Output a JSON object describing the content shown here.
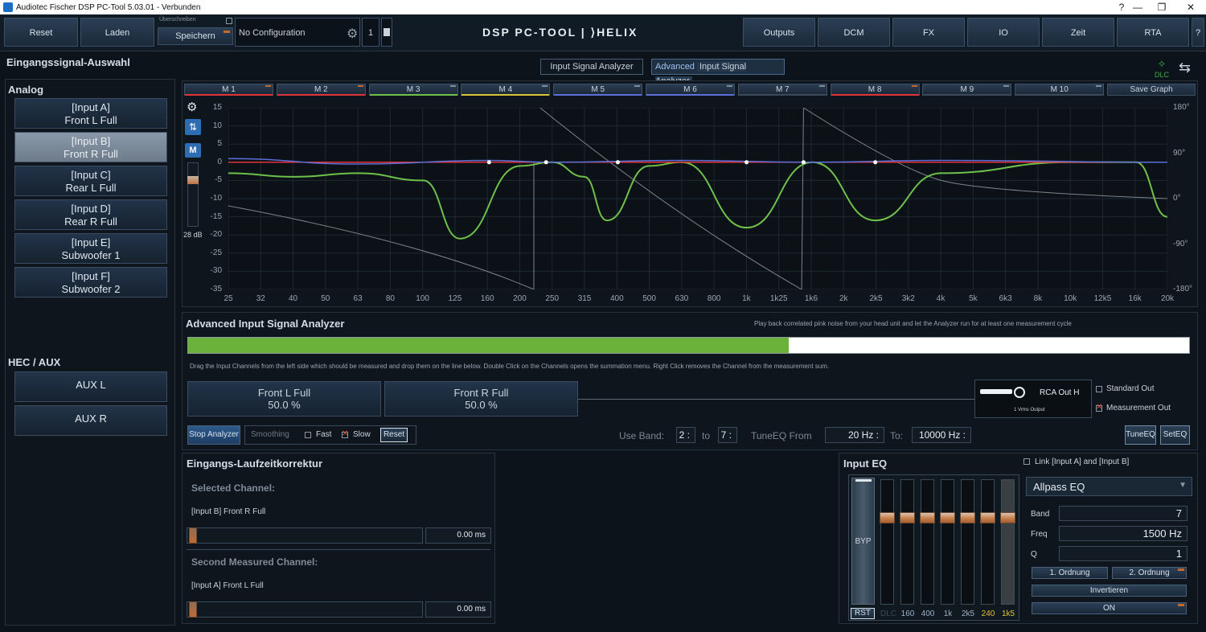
{
  "window": {
    "title": "Audiotec Fischer DSP PC-Tool 5.03.01 - Verbunden",
    "min": "—",
    "max": "❐",
    "close": "✕",
    "help": "?"
  },
  "toolbar": {
    "reset": "Reset",
    "laden": "Laden",
    "ueberschreiben": "Überschreiben",
    "speichern": "Speichern",
    "config": "No Configuration",
    "preset_num": "1",
    "logo": "DSP PC-TOOL | ⟩HELIX",
    "outputs": "Outputs",
    "dcm": "DCM",
    "fx": "FX",
    "io": "IO",
    "zeit": "Zeit",
    "rta": "RTA",
    "help": "?"
  },
  "left": {
    "title": "Eingangssignal-Auswahl",
    "analog": "Analog",
    "inputs": [
      {
        "l1": "[Input A]",
        "l2": "Front L Full"
      },
      {
        "l1": "[Input B]",
        "l2": "Front R Full"
      },
      {
        "l1": "[Input C]",
        "l2": "Rear L Full"
      },
      {
        "l1": "[Input D]",
        "l2": "Rear R Full"
      },
      {
        "l1": "[Input E]",
        "l2": "Subwoofer 1"
      },
      {
        "l1": "[Input F]",
        "l2": "Subwoofer 2"
      }
    ],
    "hec": "HEC / AUX",
    "aux": [
      "AUX L",
      "AUX R"
    ]
  },
  "tabs": {
    "isa": "Input Signal Analyzer",
    "adv_prefix": "Advanced",
    "adv": "Input Signal Analyzer",
    "dlc": "DLC"
  },
  "mem": [
    "M 1",
    "M 2",
    "M 3",
    "M 4",
    "M 5",
    "M 6",
    "M 7",
    "M 8",
    "M 9",
    "M 10"
  ],
  "save_graph": "Save Graph",
  "graph": {
    "db_label": "28 dB",
    "m": "M",
    "y_ticks": [
      "15",
      "10",
      "5",
      "0",
      "-5",
      "-10",
      "-15",
      "-20",
      "-25",
      "-30",
      "-35"
    ],
    "phase_ticks": [
      "180°",
      "90°",
      "0°",
      "-90°",
      "-180°"
    ],
    "x_ticks": [
      "25",
      "32",
      "40",
      "50",
      "63",
      "80",
      "100",
      "125",
      "160",
      "200",
      "250",
      "315",
      "400",
      "500",
      "630",
      "800",
      "1k",
      "1k25",
      "1k6",
      "2k",
      "2k5",
      "3k2",
      "4k",
      "5k",
      "6k3",
      "8k",
      "10k",
      "12k5",
      "16k",
      "20k"
    ]
  },
  "chart_data": {
    "type": "line",
    "xlabel": "",
    "ylabel": "",
    "y_unit": "dB",
    "ylim": [
      -35,
      15
    ],
    "phase_lim": [
      -180,
      180
    ],
    "grid": true,
    "series": [
      {
        "color": "#6fc04a",
        "x": [
          25,
          40,
          63,
          100,
          130,
          200,
          250,
          315,
          370,
          500,
          630,
          1000,
          1600,
          2500,
          4000,
          10000,
          16000,
          20000
        ],
        "y": [
          -3,
          -4,
          -3,
          -5,
          -21,
          -1,
          0,
          -4,
          -16,
          -1,
          0,
          -18,
          0,
          -16,
          -3,
          0,
          0,
          -15
        ]
      },
      {
        "color": "#e0333a",
        "x": [
          25,
          20000
        ],
        "y": [
          0,
          0
        ]
      },
      {
        "color": "#5b6fd8",
        "x": [
          25,
          63,
          160,
          250,
          630,
          1600,
          4000,
          20000
        ],
        "y": [
          1,
          -0.5,
          0.5,
          0,
          0.5,
          0,
          0.5,
          0
        ]
      }
    ],
    "markers_hz": [
      160,
      240,
      400,
      1000,
      1500,
      2500
    ]
  },
  "adv": {
    "title": "Advanced Input Signal Analyzer",
    "hint": "Play back correlated pink noise from your head unit and let the Analyzer run for at least one measurement cycle",
    "progress": 0.6,
    "drag_hint": "Drag the Input Channels from the left side which should be measured and drop them on the line below. Double Click on the Channels opens the summation menu. Right Click removes the Channel from the measurement sum.",
    "ch1": {
      "name": "Front L Full",
      "pct": "50.0 %"
    },
    "ch2": {
      "name": "Front R Full",
      "pct": "50.0 %"
    },
    "rca": "RCA Out H",
    "vrms": "1 Vrms Output",
    "std_out": "Standard Out",
    "meas_out": "Measurement Out",
    "stop": "Stop Analyzer",
    "smoothing": "Smoothing",
    "fast": "Fast",
    "slow": "Slow",
    "reset": "Reset",
    "use_band": "Use Band:",
    "band_from": "2",
    "to": "to",
    "band_to": "7",
    "tune_from": "TuneEQ From",
    "f_from": "20 Hz",
    "to2": "To:",
    "f_to": "10000 Hz",
    "tuneeq": "TuneEQ",
    "seteq": "SetEQ"
  },
  "delay": {
    "title": "Eingangs-Laufzeitkorrektur",
    "sel": "Selected Channel:",
    "sel_ch": "[Input B] Front R Full",
    "val1": "0.00 ms",
    "second": "Second Measured Channel:",
    "sec_ch": "[Input A] Front L Full",
    "val2": "0.00 ms"
  },
  "eq": {
    "title": "Input EQ",
    "link": "Link [Input A] and [Input B]",
    "type": "Allpass EQ",
    "band_l": "Band",
    "band": "7",
    "freq_l": "Freq",
    "freq": "1500 Hz",
    "q_l": "Q",
    "q": "1",
    "ord1": "1. Ordnung",
    "ord2": "2. Ordnung",
    "inv": "Invertieren",
    "on": "ON",
    "byp": "BYP",
    "rst": "RST",
    "dlc": "DLC",
    "bands": [
      "160",
      "400",
      "1k",
      "2k5",
      "240",
      "1k5"
    ]
  }
}
